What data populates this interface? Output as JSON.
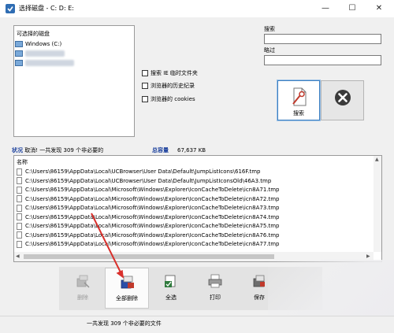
{
  "window": {
    "title": "选择磁盘 - C: D: E:",
    "minimize_glyph": "—",
    "maximize_glyph": "☐",
    "close_glyph": "✕"
  },
  "drives": {
    "title": "可选择的磁盘",
    "items": [
      {
        "label": "Windows (C:)"
      }
    ]
  },
  "options": {
    "items": [
      {
        "label": "搜索 IE 临时文件夹",
        "checked": false
      },
      {
        "label": "浏览器的历史纪录",
        "checked": false
      },
      {
        "label": "浏览器的 cookies",
        "checked": false
      }
    ]
  },
  "search": {
    "label": "搜索",
    "value": "",
    "skip_label": "略过",
    "skip_value": ""
  },
  "buttons": {
    "search_label": "搜索"
  },
  "status": {
    "label": "状况",
    "text": "取消! 一共发现 309 个非必要的",
    "total_label": "总容量",
    "total_value": "67,637 KB"
  },
  "list": {
    "header": "名称",
    "rows": [
      "C:\\Users\\86159\\AppData\\Local\\UCBrowser\\User Data\\Default\\JumpListIcons\\616F.tmp",
      "C:\\Users\\86159\\AppData\\Local\\UCBrowser\\User Data\\Default\\JumpListIconsOld\\46A3.tmp",
      "C:\\Users\\86159\\AppData\\Local\\Microsoft\\Windows\\Explorer\\IconCacheToDelete\\icn8A71.tmp",
      "C:\\Users\\86159\\AppData\\Local\\Microsoft\\Windows\\Explorer\\IconCacheToDelete\\icn8A72.tmp",
      "C:\\Users\\86159\\AppData\\Local\\Microsoft\\Windows\\Explorer\\IconCacheToDelete\\icn8A73.tmp",
      "C:\\Users\\86159\\AppData\\Local\\Microsoft\\Windows\\Explorer\\IconCacheToDelete\\icn8A74.tmp",
      "C:\\Users\\86159\\AppData\\Local\\Microsoft\\Windows\\Explorer\\IconCacheToDelete\\icn8A75.tmp",
      "C:\\Users\\86159\\AppData\\Local\\Microsoft\\Windows\\Explorer\\IconCacheToDelete\\icn8A76.tmp",
      "C:\\Users\\86159\\AppData\\Local\\Microsoft\\Windows\\Explorer\\IconCacheToDelete\\icn8A77.tmp"
    ]
  },
  "toolbar": {
    "delete_label": "删除",
    "delete_all_label": "全部删除",
    "select_all_label": "全选",
    "print_label": "打印",
    "save_label": "保存"
  },
  "footer": {
    "text": "一共发现 309 个非必要的文件"
  },
  "colors": {
    "accent": "#1a3f9c",
    "selection_border": "#3c7fc0",
    "annotation_arrow": "#d9302c"
  }
}
